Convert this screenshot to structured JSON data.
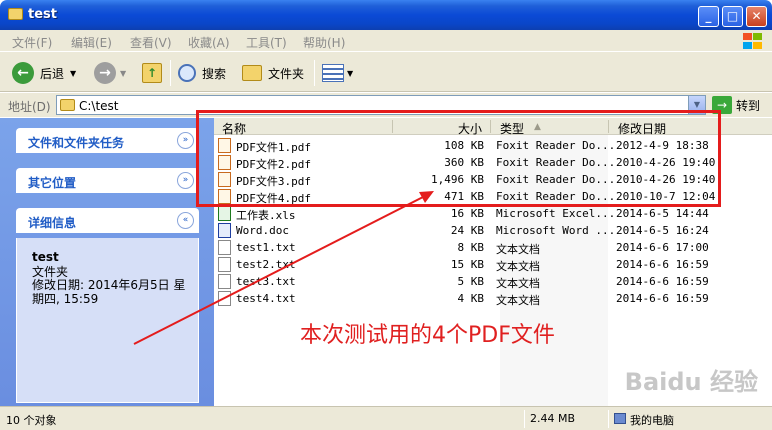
{
  "window": {
    "title": "test"
  },
  "menu": [
    "文件(F)",
    "编辑(E)",
    "查看(V)",
    "收藏(A)",
    "工具(T)",
    "帮助(H)"
  ],
  "toolbar": {
    "back": "后退",
    "search": "搜索",
    "folders": "文件夹"
  },
  "address": {
    "label": "地址(D)",
    "value": "C:\\test",
    "go": "转到"
  },
  "tasks": [
    {
      "label": "文件和文件夹任务",
      "chevron": "»"
    },
    {
      "label": "其它位置",
      "chevron": "»"
    },
    {
      "label": "详细信息",
      "chevron": "«"
    }
  ],
  "details": {
    "name": "test",
    "type": "文件夹",
    "modified": "修改日期: 2014年6月5日 星期四, 15:59"
  },
  "columns": {
    "name": "名称",
    "size": "大小",
    "type": "类型",
    "date": "修改日期"
  },
  "files": [
    {
      "name": "PDF文件1.pdf",
      "size": "108 KB",
      "type": "Foxit Reader Do...",
      "date": "2012-4-9 18:38",
      "kind": "pdf"
    },
    {
      "name": "PDF文件2.pdf",
      "size": "360 KB",
      "type": "Foxit Reader Do...",
      "date": "2010-4-26 19:40",
      "kind": "pdf"
    },
    {
      "name": "PDF文件3.pdf",
      "size": "1,496 KB",
      "type": "Foxit Reader Do...",
      "date": "2010-4-26 19:40",
      "kind": "pdf"
    },
    {
      "name": "PDF文件4.pdf",
      "size": "471 KB",
      "type": "Foxit Reader Do...",
      "date": "2010-10-7 12:04",
      "kind": "pdf"
    },
    {
      "name": "工作表.xls",
      "size": "16 KB",
      "type": "Microsoft Excel...",
      "date": "2014-6-5 14:44",
      "kind": "xls"
    },
    {
      "name": "Word.doc",
      "size": "24 KB",
      "type": "Microsoft Word ...",
      "date": "2014-6-5 16:24",
      "kind": "doc"
    },
    {
      "name": "test1.txt",
      "size": "8 KB",
      "type": "文本文档",
      "date": "2014-6-6 17:00",
      "kind": "txt"
    },
    {
      "name": "test2.txt",
      "size": "15 KB",
      "type": "文本文档",
      "date": "2014-6-6 16:59",
      "kind": "txt"
    },
    {
      "name": "test3.txt",
      "size": "5 KB",
      "type": "文本文档",
      "date": "2014-6-6 16:59",
      "kind": "txt"
    },
    {
      "name": "test4.txt",
      "size": "4 KB",
      "type": "文本文档",
      "date": "2014-6-6 16:59",
      "kind": "txt"
    }
  ],
  "annotation": "本次测试用的4个PDF文件",
  "status": {
    "count": "10 个对象",
    "size": "2.44 MB",
    "location": "我的电脑"
  },
  "watermark": "Baidu 经验",
  "colors": {
    "highlight": "#e41c1c",
    "titlebar": "#0a46c8",
    "taskpane": "#7ba3ea"
  }
}
